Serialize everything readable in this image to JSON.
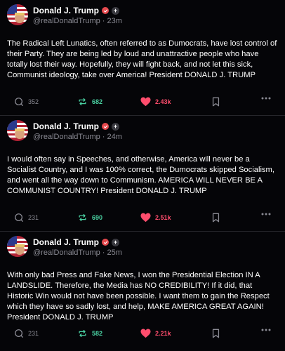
{
  "posts": [
    {
      "author": "Donald J. Trump",
      "handle": "@realDonaldTrump",
      "time": "23m",
      "text": "The Radical Left Lunatics, often referred to as Dumocrats, have lost control of their Party. They are being led by loud and unattractive people who have totally lost their way. Hopefully, they will fight back, and not let this sick, Communist ideology, take over America! President DONALD J. TRUMP",
      "replies": "352",
      "reposts": "682",
      "likes": "2.43k"
    },
    {
      "author": "Donald J. Trump",
      "handle": "@realDonaldTrump",
      "time": "24m",
      "text": "I would often say in Speeches, and otherwise, America will never be a Socialist Country, and I was 100% correct, the Dumocrats skipped Socialism, and went all the way down to Communism. AMERICA WILL NEVER BE A COMMUNIST COUNTRY! President DONALD J. TRUMP",
      "replies": "231",
      "reposts": "690",
      "likes": "2.51k"
    },
    {
      "author": "Donald J. Trump",
      "handle": "@realDonaldTrump",
      "time": "25m",
      "text": "With only bad Press and Fake News, I won the Presidential Election IN A LANDSLIDE. Therefore, the Media has NO CREDIBILITY! If it did, that Historic Win would not have been possible. I want them to gain the Respect which they have so sadly lost, and help, MAKE AMERICA GREAT AGAIN! President DONALD J. TRUMP",
      "replies": "231",
      "reposts": "582",
      "likes": "2.21k"
    }
  ],
  "icons": {
    "reply": "comment-icon",
    "repost": "repost-icon",
    "like": "heart-icon",
    "bookmark": "bookmark-icon",
    "more": "more-icon",
    "verified": "verified-check-icon",
    "follow": "plus-icon"
  },
  "colors": {
    "background": "#050508",
    "muted": "#8a8a93",
    "repost": "#4ad1a2",
    "like": "#ff4d6d",
    "verified": "#e5484d"
  }
}
